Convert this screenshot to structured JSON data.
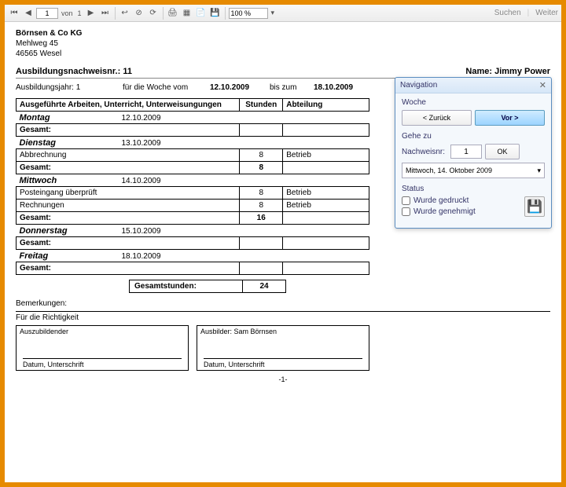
{
  "toolbar": {
    "page_current": "1",
    "page_of": "von",
    "page_total": "1",
    "zoom": "100 %",
    "search": "Suchen",
    "next": "Weiter"
  },
  "company": {
    "name": "Börnsen & Co KG",
    "street": "Mehlweg 45",
    "city": "46565 Wesel"
  },
  "header": {
    "record_label": "Ausbildungsnachweisnr.:",
    "record_no": "11",
    "name_label": "Name:",
    "name": "Jimmy Power"
  },
  "week": {
    "year_label": "Ausbildungsjahr:",
    "year": "1",
    "from_label": "für die Woche vom",
    "from": "12.10.2009",
    "to_label": "bis zum",
    "to": "18.10.2009"
  },
  "table": {
    "col_work": "Ausgeführte Arbeiten, Unterricht, Unterweisungungen",
    "col_hours": "Stunden",
    "col_dept": "Abteilung",
    "total_label": "Gesamt:",
    "days": [
      {
        "name": "Montag",
        "date": "12.10.2009",
        "rows": [],
        "total": ""
      },
      {
        "name": "Dienstag",
        "date": "13.10.2009",
        "rows": [
          {
            "work": "Abbrechnung",
            "hours": "8",
            "dept": "Betrieb"
          }
        ],
        "total": "8"
      },
      {
        "name": "Mittwoch",
        "date": "14.10.2009",
        "rows": [
          {
            "work": "Posteingang überprüft",
            "hours": "8",
            "dept": "Betrieb"
          },
          {
            "work": "Rechnungen",
            "hours": "8",
            "dept": "Betrieb"
          }
        ],
        "total": "16"
      },
      {
        "name": "Donnerstag",
        "date": "15.10.2009",
        "rows": [],
        "total": ""
      },
      {
        "name": "Freitag",
        "date": "18.10.2009",
        "rows": [],
        "total": ""
      }
    ],
    "grand_total_label": "Gesamtstunden:",
    "grand_total": "24"
  },
  "remarks_label": "Bemerkungen:",
  "correctness": "Für die Richtigkeit",
  "sign": {
    "trainee": "Auszubildender",
    "trainer": "Ausbilder: Sam Börnsen",
    "caption": "Datum, Unterschrift"
  },
  "page_num": "-1-",
  "nav": {
    "title": "Navigation",
    "week_label": "Woche",
    "back": "< Zurück",
    "forward": "Vor >",
    "goto_label": "Gehe zu",
    "record_field": "Nachweisnr:",
    "record_value": "1",
    "ok": "OK",
    "date": "Mittwoch, 14. Oktober 2009",
    "status_label": "Status",
    "printed": "Wurde gedruckt",
    "approved": "Wurde genehmigt"
  }
}
